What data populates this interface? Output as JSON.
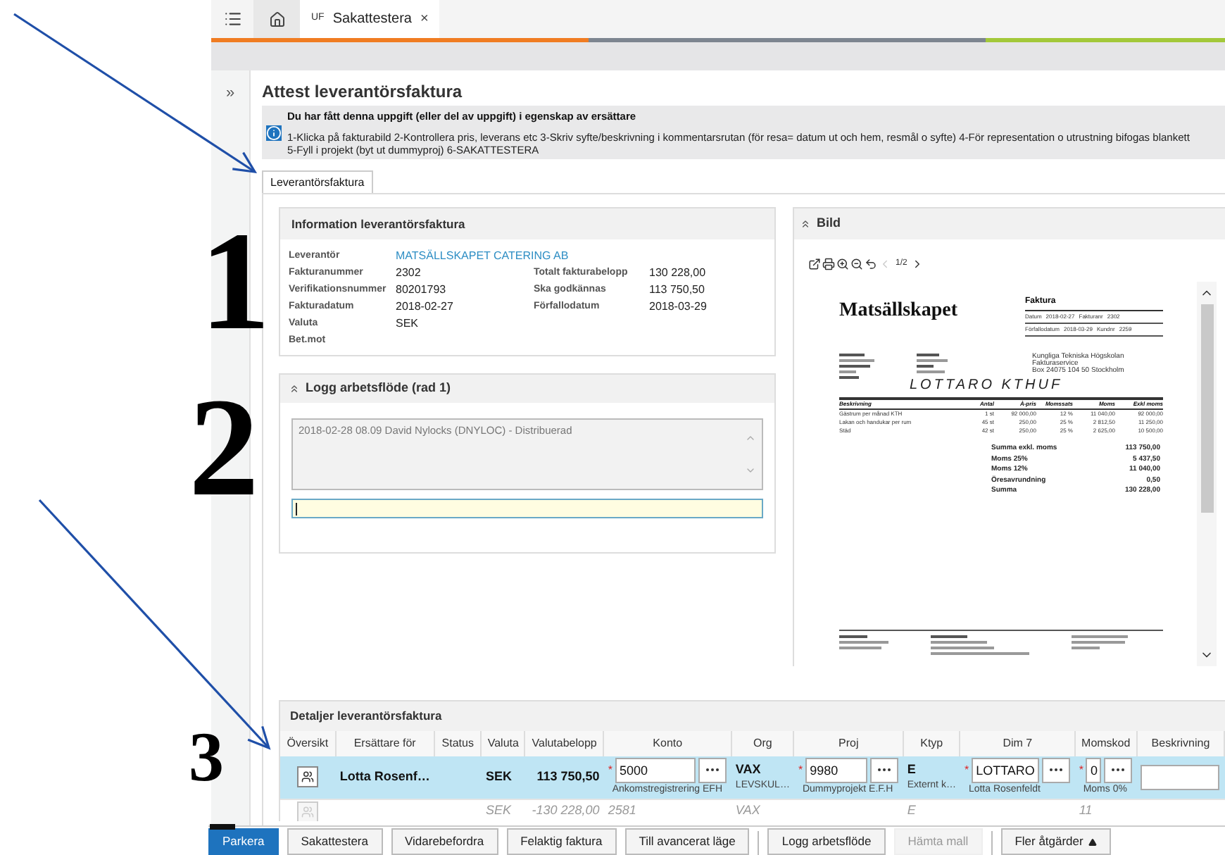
{
  "annotation_numbers": [
    "1",
    "2",
    "3"
  ],
  "tabbar": {
    "tabs": [
      {
        "prefix": "UF",
        "label": "Sakattestera",
        "close": "×",
        "selected": true
      }
    ]
  },
  "sidebar_toggle": "»",
  "page_title": "Attest leverantörsfaktura",
  "notice": {
    "heading": "Du har fått denna uppgift (eller del av uppgift) i egenskap av ersättare",
    "lines": [
      "1-Klicka på fakturabild 2-Kontrollera pris, leverans etc 3-Skriv syfte/beskrivning i kommentarsrutan (för resa= datum ut och hem, resmål o syfte) 4-För representation o utrustning bifogas blankett",
      "5-Fyll i projekt (byt ut dummyproj) 6-SAKATTESTERA"
    ]
  },
  "tabs": [
    {
      "label": "Leverantörsfaktura",
      "selected": true
    }
  ],
  "info_panel": {
    "title": "Information leverantörsfaktura",
    "rows": [
      {
        "label": "Leverantör",
        "value": "MATSÄLLSKAPET CATERING AB",
        "kind": "link"
      },
      {
        "label": "Fakturanummer",
        "value": "2302",
        "kind": "text",
        "right": {
          "label": "Totalt fakturabelopp",
          "value": "130 228,00"
        }
      },
      {
        "label": "Verifikationsnummer",
        "value": "80201793",
        "kind": "text",
        "right": {
          "label": "Ska godkännas",
          "value": "113 750,50"
        }
      },
      {
        "label": "Fakturadatum",
        "value": "2018-02-27",
        "kind": "text",
        "right": {
          "label": "Förfallodatum",
          "value": "2018-03-29"
        }
      },
      {
        "label": "Valuta",
        "value": "SEK",
        "kind": "text"
      },
      {
        "label": "Bet.mot"
      }
    ]
  },
  "log_panel": {
    "title": "Logg arbetsflöde (rad 1)",
    "expanded": true,
    "entries": [
      "2018-02-28 08.09 David Nylocks (DNYLOC) - Distribuerad"
    ]
  },
  "image_panel": {
    "title": "Bild",
    "expanded": true,
    "page": "1/2",
    "document": {
      "company": "Matsällskapet",
      "doc_title": "Faktura",
      "meta": [
        [
          "Datum",
          "2018-02-27",
          "Fakturanr",
          "2302"
        ],
        [
          "Förfallodatum",
          "2018-03-29",
          "Kundnr",
          "2259"
        ]
      ],
      "recipient": [
        "Kungliga Tekniska Högskolan",
        "Fakturaservice",
        "Box 24075 104 50 Stockholm"
      ],
      "handwriting": "LOTTARO KTHUF",
      "line_columns": [
        "Beskrivning",
        "Antal",
        "À-pris",
        "Momssats",
        "Moms",
        "Exkl moms"
      ],
      "lines": [
        [
          "Gästrum per månad KTH",
          "1 st",
          "92 000,00",
          "12 %",
          "11 040,00",
          "92 000,00"
        ],
        [
          "Lakan och handukar per rum",
          "45 st",
          "250,00",
          "25 %",
          "2 812,50",
          "11 250,00"
        ],
        [
          "Städ",
          "42 st",
          "250,00",
          "25 %",
          "2 625,00",
          "10 500,00"
        ]
      ],
      "totals": [
        [
          "Summa exkl. moms",
          "113 750,00"
        ],
        [
          "Moms 25%",
          "5 437,50"
        ],
        [
          "Moms 12%",
          "11 040,00"
        ],
        [
          "Öresavrundning",
          "0,50"
        ],
        [
          "Summa",
          "130 228,00"
        ]
      ]
    }
  },
  "details": {
    "title": "Detaljer leverantörsfaktura",
    "columns": [
      "Översikt",
      "Ersättare för",
      "Status",
      "Valuta",
      "Valutabelopp",
      "Konto",
      "Org",
      "Proj",
      "Ktyp",
      "Dim 7",
      "Momskod",
      "Beskrivning"
    ],
    "rows": [
      {
        "selected": true,
        "disabled": false,
        "cells": [
          {
            "kind": "icon"
          },
          {
            "kind": "text",
            "text": "Lotta Rosenf…"
          },
          null,
          {
            "kind": "text",
            "text": "SEK"
          },
          {
            "kind": "number",
            "text": "113 750,50"
          },
          {
            "kind": "input",
            "mark": "*",
            "text": "5000",
            "sub": "Ankomstregistrering EFH"
          },
          {
            "kind": "text",
            "text": "VAX",
            "sub": "LEVSKUL…"
          },
          {
            "kind": "input",
            "mark": "*",
            "text": "9980",
            "sub": "Dummyprojekt E.F.H"
          },
          {
            "kind": "text",
            "text": "E",
            "sub": "Externt k…"
          },
          {
            "kind": "input",
            "mark": "*",
            "text": "LOTTARO",
            "sub": "Lotta Rosenfeldt"
          },
          {
            "kind": "input",
            "mark": "*",
            "text": "0",
            "sub": "Moms 0%"
          },
          {
            "kind": "field"
          }
        ]
      },
      {
        "selected": false,
        "disabled": true,
        "cells": [
          {
            "kind": "icon"
          },
          null,
          null,
          {
            "kind": "text",
            "text": "SEK"
          },
          {
            "kind": "number",
            "text": "-130 228,00"
          },
          {
            "kind": "text",
            "text": "2581"
          },
          {
            "kind": "text",
            "text": "VAX"
          },
          null,
          {
            "kind": "text",
            "text": "E"
          },
          null,
          {
            "kind": "text",
            "text": "11"
          },
          null
        ]
      }
    ]
  },
  "buttons": [
    {
      "label": "Parkera",
      "kind": "primary",
      "disabled": false
    },
    {
      "label": "Sakattestera",
      "kind": "normal",
      "disabled": false
    },
    {
      "label": "Vidarebefordra",
      "kind": "normal",
      "disabled": false
    },
    {
      "label": "Felaktig faktura",
      "kind": "normal",
      "disabled": false
    },
    {
      "label": "Till avancerat läge",
      "kind": "normal",
      "disabled": false,
      "separator_after": true
    },
    {
      "label": "Logg arbetsflöde",
      "kind": "normal",
      "disabled": false
    },
    {
      "label": "Hämta mall",
      "kind": "normal",
      "disabled": true,
      "separator_after": true
    },
    {
      "label": "Fler åtgärder",
      "kind": "menu",
      "disabled": false
    }
  ]
}
